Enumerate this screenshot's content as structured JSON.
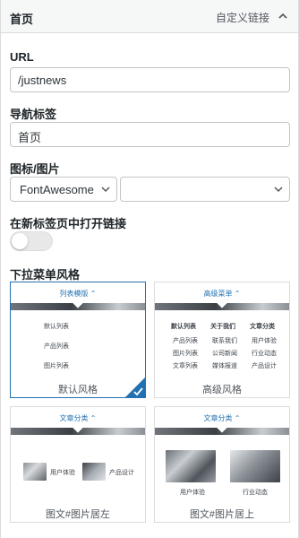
{
  "header": {
    "title": "首页",
    "type_label": "自定义链接"
  },
  "url": {
    "label": "URL",
    "value": "/justnews"
  },
  "nav_label": {
    "label": "导航标签",
    "value": "首页"
  },
  "icon": {
    "label": "图标/图片",
    "icon_type": "FontAwesome",
    "icon_value": ""
  },
  "new_tab": {
    "label": "在新标签页中打开链接",
    "enabled": false
  },
  "dropdown": {
    "label": "下拉菜单风格",
    "options": [
      {
        "tab": "列表模版",
        "caption": "默认风格",
        "selected": true,
        "items": [
          "默认列表",
          "产品列表",
          "图片列表"
        ]
      },
      {
        "tab": "高级菜单",
        "caption": "高级风格",
        "selected": false,
        "columns": [
          {
            "heading": "默认列表",
            "items": [
              "产品列表",
              "图片列表",
              "文章列表"
            ]
          },
          {
            "heading": "关于我们",
            "items": [
              "联系我们",
              "公司新闻",
              "媒体报道"
            ]
          },
          {
            "heading": "文章分类",
            "items": [
              "用户体验",
              "行业动态",
              "产品设计"
            ]
          }
        ]
      },
      {
        "tab": "文章分类",
        "caption": "图文#图片居左",
        "selected": false,
        "items": [
          "用户体验",
          "产品设计"
        ]
      },
      {
        "tab": "文章分类",
        "caption": "图文#图片居上",
        "selected": false,
        "items": [
          "用户体验",
          "行业动态"
        ]
      }
    ]
  },
  "colors": {
    "accent": "#2271b1",
    "border": "#dcdcde",
    "header_bg": "#f6f7f7"
  }
}
